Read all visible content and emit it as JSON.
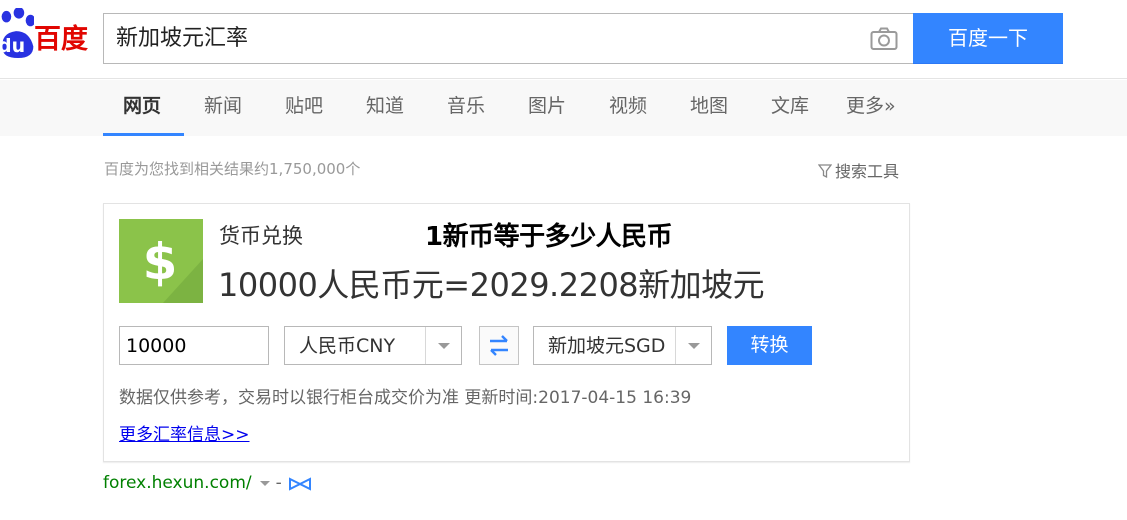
{
  "brand": {
    "logo_text": "百度",
    "logo_du": "du",
    "accent": "#e10601"
  },
  "search": {
    "query": "新加坡元汇率",
    "button_label": "百度一下",
    "accent": "#3385ff"
  },
  "tabs": [
    {
      "label": "网页",
      "active": true
    },
    {
      "label": "新闻"
    },
    {
      "label": "贴吧"
    },
    {
      "label": "知道"
    },
    {
      "label": "音乐"
    },
    {
      "label": "图片"
    },
    {
      "label": "视频"
    },
    {
      "label": "地图"
    },
    {
      "label": "文库"
    },
    {
      "label": "更多»"
    }
  ],
  "results_info": {
    "count_text": "百度为您找到相关结果约1,750,000个",
    "tools_label": "搜索工具"
  },
  "card": {
    "title": "货币兑换",
    "overlay_question": "1新币等于多少人民币",
    "result_text": "10000人民币元=2029.2208新加坡元",
    "amount_value": "10000",
    "from_currency": "人民币CNY",
    "to_currency": "新加坡元SGD",
    "convert_label": "转换",
    "disclaimer": "数据仅供参考，交易时以银行柜台成交价为准 更新时间:2017-04-15 16:39",
    "more_link": "更多汇率信息>>"
  },
  "source": {
    "url": "forex.hexun.com/",
    "dash": "-"
  }
}
